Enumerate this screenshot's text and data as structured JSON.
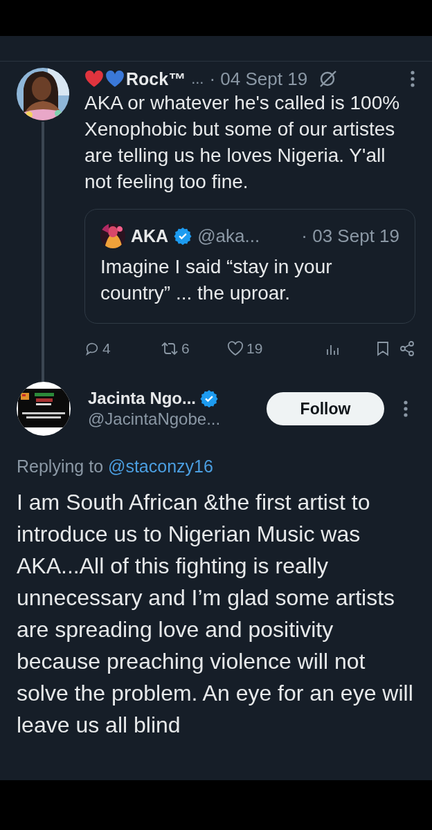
{
  "tweet": {
    "name": "Rock™",
    "name_ellipsis": "...",
    "date": "· 04 Sept 19",
    "text": "AKA or whatever he's called is 100% Xenophobic but some of our artistes are telling us he loves Nigeria. Y'all not feeling too fine.",
    "quote": {
      "name": "AKA",
      "verified": true,
      "handle": "@aka...",
      "date": "· 03 Sept 19",
      "text": "Imagine I said “stay in your country” ... the uproar."
    },
    "actions": [
      {
        "kind": "reply",
        "count": "4"
      },
      {
        "kind": "repost",
        "count": "6"
      },
      {
        "kind": "like",
        "count": "19"
      },
      {
        "kind": "views"
      },
      {
        "kind": "bookmark"
      },
      {
        "kind": "share"
      }
    ]
  },
  "reply": {
    "name": "Jacinta Ngo...",
    "verified": true,
    "handle": "@JacintaNgobe...",
    "follow": "Follow",
    "replying_label": "Replying to",
    "replying_to": "@staconzy16",
    "text": "I am South African &the first artist to introduce us to Nigerian Music was AKA...All of this fighting is really unnecessary and I’m glad some artists are spreading love and positivity because preaching violence will not solve the problem. An eye for an eye will leave us all blind"
  }
}
